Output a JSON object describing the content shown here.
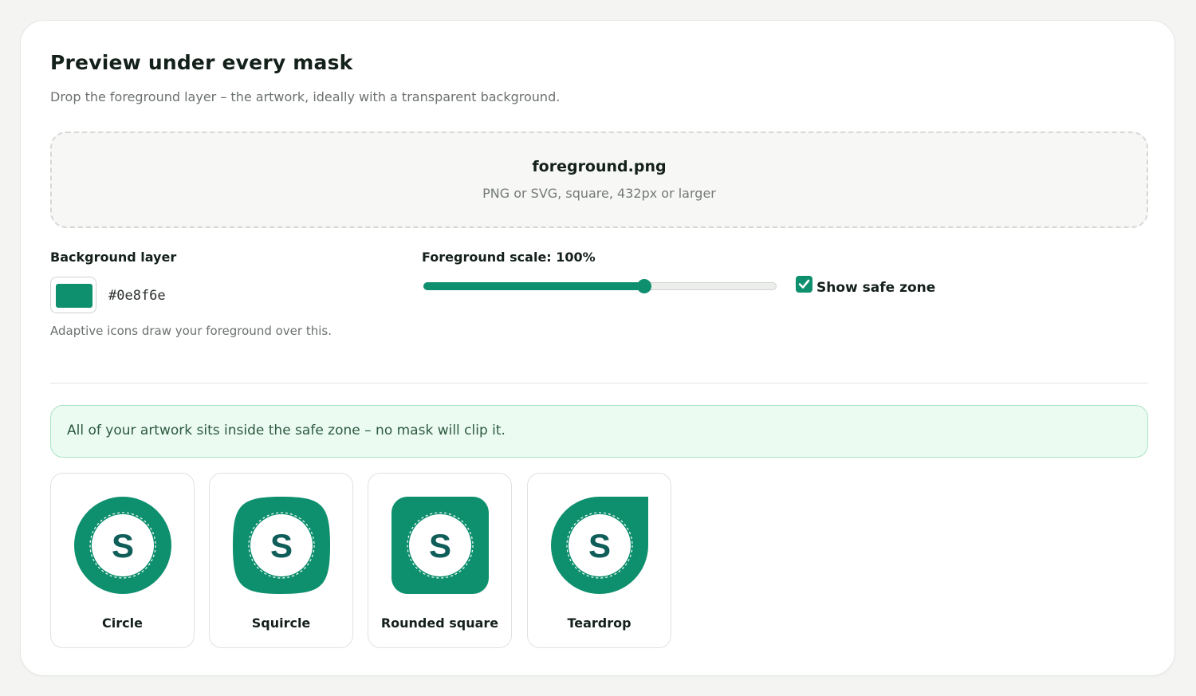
{
  "colors": {
    "accent": "#0e8f6e",
    "letter": "#0f5e59",
    "notice_border": "#a9e3c3",
    "notice_bg": "#ecfbf2"
  },
  "header": {
    "title": "Preview under every mask",
    "subtitle": "Drop the foreground layer – the artwork, ideally with a transparent background."
  },
  "dropzone": {
    "filename": "foreground.png",
    "hint": "PNG or SVG, square, 432px or larger"
  },
  "background_layer": {
    "label": "Background layer",
    "hex": "#0e8f6e",
    "helper": "Adaptive icons draw your foreground over this."
  },
  "foreground_scale": {
    "label": "Foreground scale: 100%",
    "value_percent": 100,
    "slider_fraction": 0.625
  },
  "safe_zone": {
    "label": "Show safe zone",
    "checked": true
  },
  "notice": {
    "text": "All of your artwork sits inside the safe zone – no mask will clip it."
  },
  "masks": [
    {
      "label": "Circle",
      "glyph": "S",
      "shape": "circle"
    },
    {
      "label": "Squircle",
      "glyph": "S",
      "shape": "squircle"
    },
    {
      "label": "Rounded square",
      "glyph": "S",
      "shape": "rounded-square"
    },
    {
      "label": "Teardrop",
      "glyph": "S",
      "shape": "teardrop"
    }
  ]
}
